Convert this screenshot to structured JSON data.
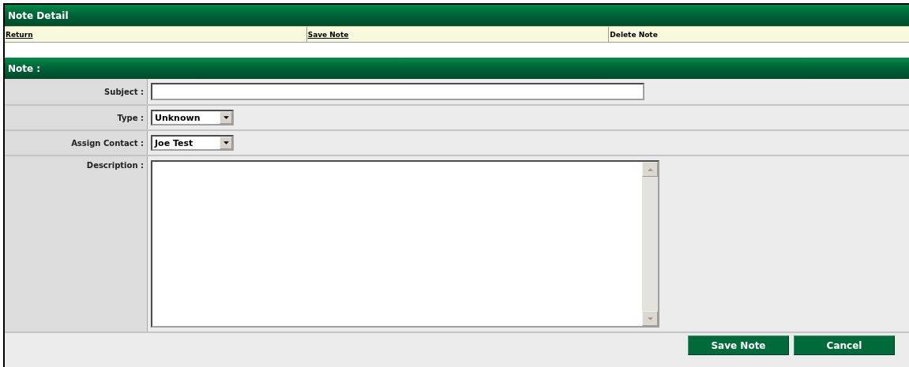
{
  "header": {
    "title": "Note Detail"
  },
  "actions": [
    {
      "label": "Return",
      "kind": "link"
    },
    {
      "label": "Save Note",
      "kind": "link"
    },
    {
      "label": "Delete Note",
      "kind": "text"
    }
  ],
  "section": {
    "title": "Note :"
  },
  "fields": [
    {
      "label": "Subject :",
      "kind": "text"
    },
    {
      "label": "Type :",
      "kind": "select",
      "value": "Unknown"
    },
    {
      "label": "Assign Contact :",
      "kind": "select",
      "value": "Joe Test"
    },
    {
      "label": "Description :",
      "kind": "textarea"
    }
  ],
  "buttons": [
    "Save Note",
    "Cancel"
  ]
}
